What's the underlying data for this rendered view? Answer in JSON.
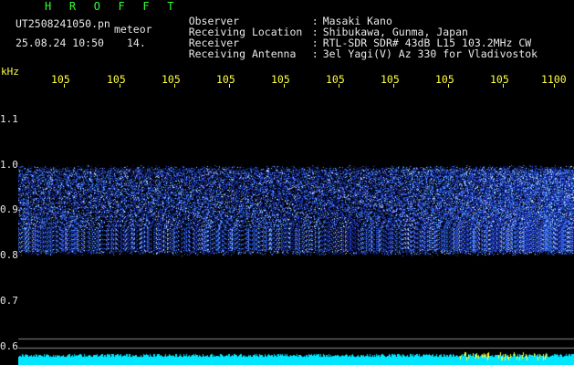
{
  "header": {
    "program": "H R O F F T",
    "filename": "UT2508241050.pn",
    "type": "meteor",
    "datetime": "25.08.24 10:50",
    "field_14": "14."
  },
  "info": [
    {
      "label": "Observer",
      "sep": ":",
      "value": "Masaki Kano"
    },
    {
      "label": "Receiving Location",
      "sep": ":",
      "value": "Shibukawa, Gunma, Japan"
    },
    {
      "label": "Receiver",
      "sep": ":",
      "value": "RTL-SDR SDR# 43dB L15 103.2MHz CW"
    },
    {
      "label": "Receiving Antenna",
      "sep": ":",
      "value": "3el Yagi(V) Az 330 for Vladivostok"
    }
  ],
  "chart_data": {
    "type": "heatmap",
    "xlabel_top": [
      "105",
      "105",
      "105",
      "105",
      "105",
      "105",
      "105",
      "105",
      "105",
      "1100"
    ],
    "yunit": "kHz",
    "yticks": [
      "1.1",
      "1.0",
      "0.9",
      "0.8",
      "0.7",
      "0.6"
    ],
    "yvalues": [
      1.1,
      1.0,
      0.9,
      0.8,
      0.7,
      0.6
    ],
    "signal_band": [
      0.8,
      1.0
    ],
    "colors": {
      "low": "#0b1c8f",
      "mid": "#2f5cff",
      "high": "#bfe3ff",
      "baseline": "#00e6ff"
    }
  }
}
